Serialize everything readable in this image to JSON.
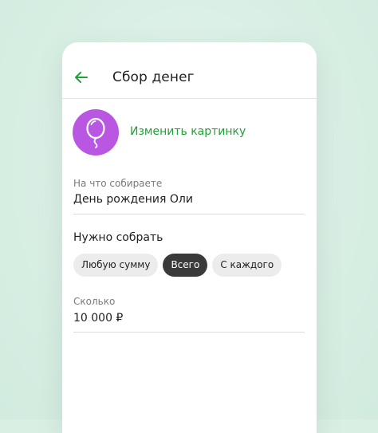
{
  "header": {
    "title": "Сбор денег",
    "back_icon": "arrow-left-icon"
  },
  "image": {
    "avatar_icon": "balloon-icon",
    "avatar_color": "#b957e3",
    "change_link": "Изменить картинку"
  },
  "purpose": {
    "label": "На что собираете",
    "value": "День рождения Оли"
  },
  "collect": {
    "title": "Нужно собрать",
    "options": [
      {
        "label": "Любую сумму",
        "selected": false
      },
      {
        "label": "Всего",
        "selected": true
      },
      {
        "label": "С каждого",
        "selected": false
      }
    ]
  },
  "amount": {
    "label": "Сколько",
    "value": "10 000 ₽"
  },
  "colors": {
    "accent": "#21a038",
    "selected_chip": "#3a3a3a",
    "background": "#d9efe4"
  }
}
